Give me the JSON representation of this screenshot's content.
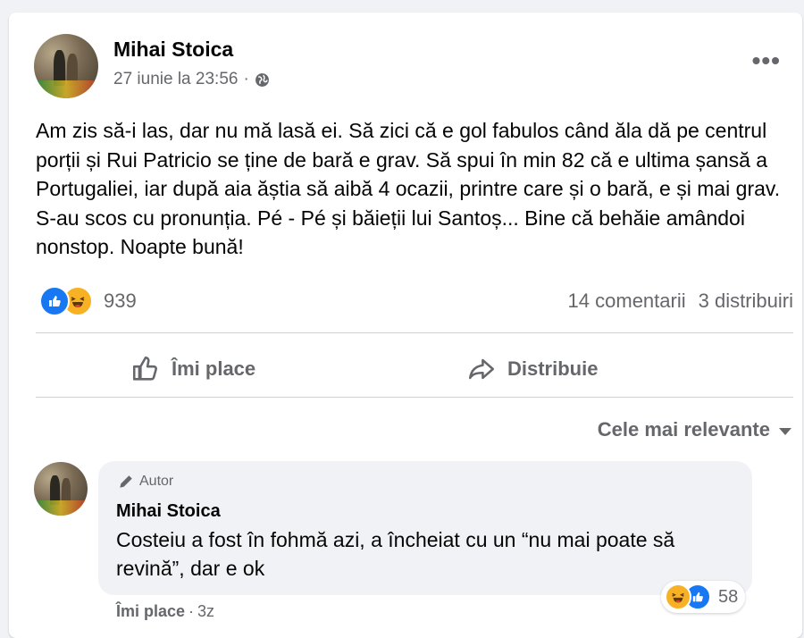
{
  "post": {
    "author": "Mihai Stoica",
    "timestamp": "27 iunie la 23:56",
    "separator": "·",
    "privacy_icon": "globe-icon",
    "more_label": "•••",
    "text": "Am zis să-i las, dar nu mă lasă ei. Să zici că e gol fabulos când ăla dă pe centrul porții și Rui Patricio se ține de bară e grav. Să spui în min 82 că e ultima șansă a Portugaliei, iar după aia ăștia să aibă 4 ocazii, printre care și o bară, e și mai grav. S-au scos cu pronunția. Pé - Pé și băieții lui Santoș... Bine că behăie amândoi nonstop. Noapte bună!",
    "reactions": {
      "icons": [
        "like-icon",
        "haha-icon"
      ],
      "count": "939"
    },
    "comments_count": "14 comentarii",
    "shares_count": "3 distribuiri"
  },
  "actions": {
    "like_label": "Îmi place",
    "share_label": "Distribuie"
  },
  "comments_section": {
    "sort_label": "Cele mai relevante"
  },
  "comment": {
    "badge_label": "Autor",
    "author": "Mihai Stoica",
    "text": "Costeiu a fost în fohmă azi, a încheiat cu un “nu mai poate să revină”, dar e ok",
    "reactions": {
      "icons": [
        "haha-icon",
        "like-icon"
      ],
      "count": "58"
    },
    "like_label": "Îmi place",
    "separator": "·",
    "time": "3z"
  },
  "colors": {
    "accent": "#1877f2",
    "haha": "#f7b125",
    "muted_text": "#65676b",
    "bubble": "#f0f2f5"
  }
}
